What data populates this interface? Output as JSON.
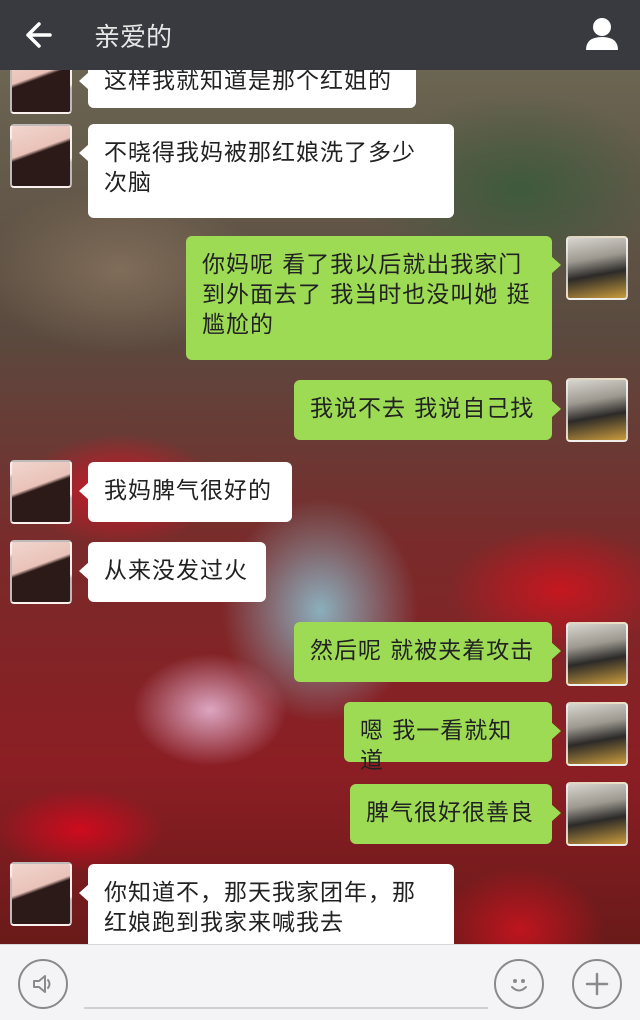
{
  "header": {
    "back_icon": "back-arrow-icon",
    "title": "亲爱的",
    "profile_icon": "person-icon"
  },
  "messages": [
    {
      "side": "left",
      "text": "这样我就知道是那个红姐的"
    },
    {
      "side": "left",
      "text": "不晓得我妈被那红娘洗了多少次脑"
    },
    {
      "side": "right",
      "text": "你妈呢 看了我以后就出我家门到外面去了 我当时也没叫她 挺尴尬的"
    },
    {
      "side": "right",
      "text": "我说不去 我说自己找"
    },
    {
      "side": "left",
      "text": "我妈脾气很好的"
    },
    {
      "side": "left",
      "text": "从来没发过火"
    },
    {
      "side": "right",
      "text": "然后呢 就被夹着攻击"
    },
    {
      "side": "right",
      "text": "嗯 我一看就知道"
    },
    {
      "side": "right",
      "text": "脾气很好很善良"
    },
    {
      "side": "left",
      "text": "你知道不，那天我家团年，那红娘跑到我家来喊我去"
    }
  ],
  "input_bar": {
    "voice_icon": "voice-icon",
    "input_value": "",
    "emoji_icon": "emoji-icon",
    "plus_icon": "plus-icon"
  },
  "colors": {
    "header_bg": "#393a3f",
    "bubble_sent": "#9ddb55",
    "bubble_received": "#ffffff",
    "input_bar_bg": "#f4f4f6"
  }
}
